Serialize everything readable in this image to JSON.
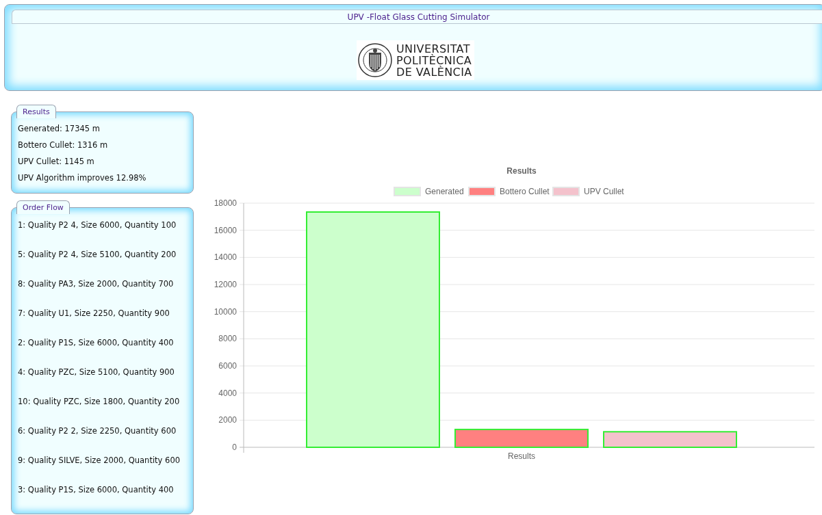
{
  "header": {
    "title": "UPV -Float Glass Cutting Simulator",
    "logo_lines": [
      "UNIVERSITAT",
      "POLITÈCNICA",
      "DE VALÈNCIA"
    ]
  },
  "results_panel": {
    "legend": "Results",
    "lines": [
      "Generated: 17345 m",
      "Bottero Cullet: 1316 m",
      "UPV Cullet: 1145 m",
      "UPV Algorithm improves 12.98%"
    ]
  },
  "order_flow_panel": {
    "legend": "Order Flow",
    "orders": [
      "1: Quality P2 4, Size 6000, Quantity 100",
      "5: Quality P2 4, Size 5100, Quantity 200",
      "8: Quality PA3, Size 2000, Quantity 700",
      "7: Quality U1, Size 2250, Quantity 900",
      "2: Quality P1S, Size 6000, Quantity 400",
      "4: Quality PZC, Size 5100, Quantity 900",
      "10: Quality PZC, Size 1800, Quantity 200",
      "6: Quality P2 2, Size 2250, Quantity 600",
      "9: Quality SILVE, Size 2000, Quantity 600",
      "3: Quality P1S, Size 6000, Quantity 400"
    ]
  },
  "chart": {
    "chart_data": {
      "type": "bar",
      "title": "Results",
      "categories": [
        "Results"
      ],
      "series": [
        {
          "name": "Generated",
          "color": "#ccffcc",
          "values": [
            17345
          ]
        },
        {
          "name": "Bottero Cullet",
          "color": "#ff8080",
          "values": [
            1316
          ]
        },
        {
          "name": "UPV Cullet",
          "color": "#f4c2cc",
          "values": [
            1145
          ]
        }
      ],
      "grid": true,
      "legend": true,
      "ylim": [
        0,
        18000
      ],
      "yticks": [
        0,
        2000,
        4000,
        6000,
        8000,
        10000,
        12000,
        14000,
        16000,
        18000
      ]
    }
  }
}
